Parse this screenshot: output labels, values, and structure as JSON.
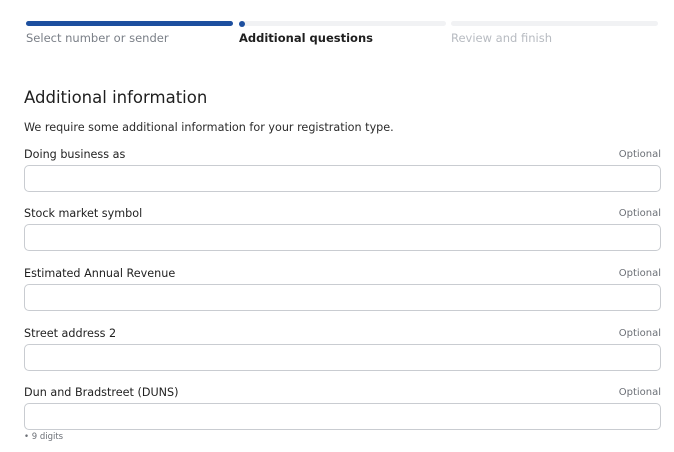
{
  "stepper": {
    "steps": [
      {
        "label": "Select number or sender",
        "state": "completed"
      },
      {
        "label": "Additional questions",
        "state": "current"
      },
      {
        "label": "Review and finish",
        "state": "upcoming"
      }
    ]
  },
  "form": {
    "title": "Additional information",
    "intro": "We require some additional information for your registration type.",
    "fields": [
      {
        "label": "Doing business as",
        "optional": "Optional",
        "value": "",
        "placeholder": ""
      },
      {
        "label": "Stock market symbol",
        "optional": "Optional",
        "value": "",
        "placeholder": ""
      },
      {
        "label": "Estimated Annual Revenue",
        "optional": "Optional",
        "value": "",
        "placeholder": ""
      },
      {
        "label": "Street address 2",
        "optional": "Optional",
        "value": "",
        "placeholder": ""
      },
      {
        "label": "Dun and Bradstreet (DUNS)",
        "optional": "Optional",
        "value": "",
        "placeholder": ""
      }
    ],
    "duns_hint": "• 9 digits"
  },
  "colors": {
    "accent": "#1d4f9f",
    "track": "#f1f2f4",
    "border": "#c9ccd1"
  }
}
